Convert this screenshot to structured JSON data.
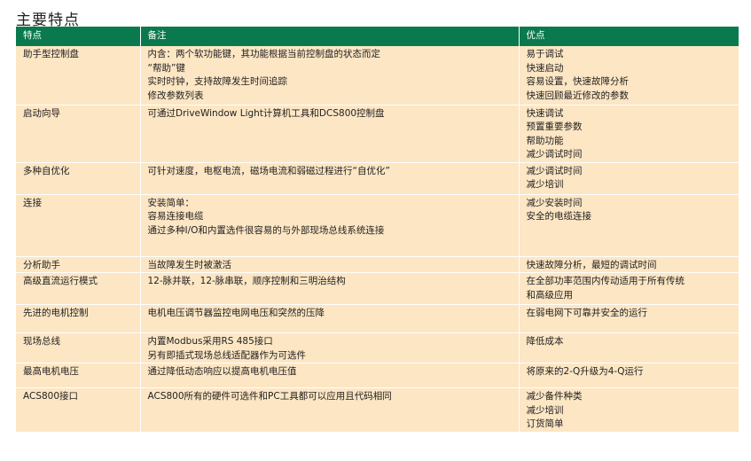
{
  "title": "主要特点",
  "headers": [
    "特点",
    "备注",
    "优点"
  ],
  "rows": [
    {
      "feature": "助手型控制盘",
      "notes": [
        "内含：两个软功能键，其功能根据当前控制盘的状态而定",
        "“帮助”键",
        "实时时钟，支持故障发生时间追踪",
        "修改参数列表"
      ],
      "benefits": [
        "易于调试",
        "快速启动",
        "容易设置，快速故障分析",
        "快速回顾最近修改的参数"
      ]
    },
    {
      "feature": "启动向导",
      "notes": [
        "可通过DriveWindow Light计算机工具和DCS800控制盘"
      ],
      "benefits": [
        "快速调试",
        "预置重要参数",
        "帮助功能",
        "减少调试时间"
      ]
    },
    {
      "feature": "多种自优化",
      "notes": [
        "可针对速度，电枢电流，磁场电流和弱磁过程进行“自优化”"
      ],
      "benefits": [
        "减少调试时间",
        "减少培训"
      ]
    },
    {
      "feature": "连接",
      "notes": [
        "安装简单：",
        "容易连接电缆",
        "通过多种I/O和内置选件很容易的与外部现场总线系统连接"
      ],
      "benefits": [
        "减少安装时间",
        "安全的电缆连接"
      ]
    },
    {
      "feature": "分析助手",
      "notes": [
        "当故障发生时被激活"
      ],
      "benefits": [
        "快速故障分析，最短的调试时间"
      ]
    },
    {
      "feature": "高级直流运行模式",
      "notes": [
        "12-脉并联，12-脉串联，顺序控制和三明治结构"
      ],
      "benefits": [
        "在全部功率范围内传动适用于所有传统",
        "和高级应用"
      ]
    },
    {
      "feature": "先进的电机控制",
      "notes": [
        "电机电压调节器监控电网电压和突然的压降"
      ],
      "benefits": [
        "在弱电网下可靠并安全的运行"
      ]
    },
    {
      "feature": "现场总线",
      "notes": [
        "内置Modbus采用RS 485接口",
        "另有即插式现场总线适配器作为可选件"
      ],
      "benefits": [
        "降低成本"
      ]
    },
    {
      "feature": "最高电机电压",
      "notes": [
        "通过降低动态响应以提高电机电压值"
      ],
      "benefits": [
        "将原来的2-Q升级为4-Q运行"
      ]
    },
    {
      "feature": "ACS800接口",
      "notes": [
        "ACS800所有的硬件可选件和PC工具都可以应用且代码相同"
      ],
      "benefits": [
        "减少备件种类",
        "减少培训",
        "订货简单"
      ]
    }
  ],
  "colors": {
    "header_bg": "#0a7a4e",
    "row_bg": "#fde6c4",
    "header_text": "#ffffff"
  }
}
